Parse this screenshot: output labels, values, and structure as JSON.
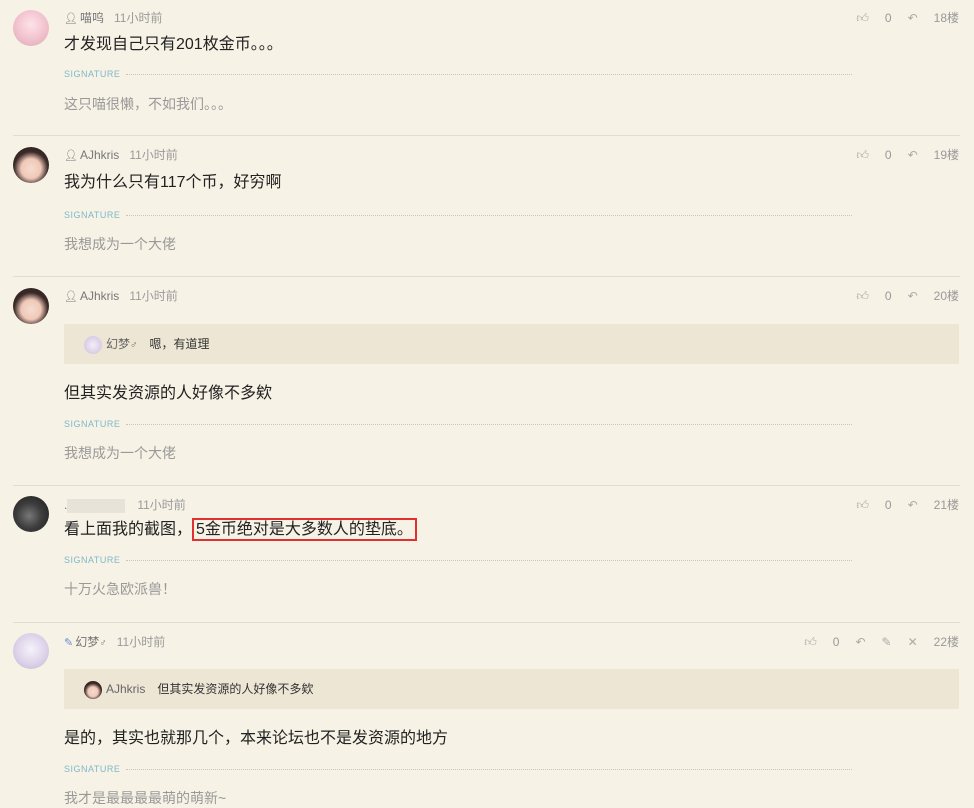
{
  "posts": [
    {
      "username": "喵呜",
      "time": "11小时前",
      "likes": "0",
      "floor": "18楼",
      "content": "才发现自己只有201枚金币。。。",
      "signature_label": "SIGNATURE",
      "signature": "这只喵很懒，不如我们。。。"
    },
    {
      "username": "AJhkris",
      "time": "11小时前",
      "likes": "0",
      "floor": "19楼",
      "content": "我为什么只有117个币，好穷啊",
      "signature_label": "SIGNATURE",
      "signature": "我想成为一个大佬"
    },
    {
      "username": "AJhkris",
      "time": "11小时前",
      "likes": "0",
      "floor": "20楼",
      "quote_user": "幻梦",
      "quote_text": "嗯，有道理",
      "content": "但其实发资源的人好像不多欸",
      "signature_label": "SIGNATURE",
      "signature": "我想成为一个大佬"
    },
    {
      "username": ".",
      "time": "11小时前",
      "likes": "0",
      "floor": "21楼",
      "content_prefix": "看上面我的截图，",
      "content_highlight": "5金币绝对是大多数人的垫底。",
      "signature_label": "SIGNATURE",
      "signature": "十万火急欧派兽！"
    },
    {
      "username": "幻梦",
      "time": "11小时前",
      "likes": "0",
      "floor": "22楼",
      "quote_user": "AJhkris",
      "quote_text": "但其实发资源的人好像不多欸",
      "content": "是的，其实也就那几个，本来论坛也不是发资源的地方",
      "signature_label": "SIGNATURE",
      "signature": "我才是最最最最萌的萌新~"
    }
  ],
  "icons": {
    "user": "user-icon",
    "thumb": "thumb-up-icon",
    "reply": "reply-icon",
    "edit": "edit-icon",
    "delete": "close-icon",
    "gender": "gender-icon"
  },
  "colors": {
    "background": "#f7f2e6",
    "signature_label": "#7fb8c9",
    "quote_bg": "#ede6d4",
    "highlight_border": "#e03030"
  }
}
